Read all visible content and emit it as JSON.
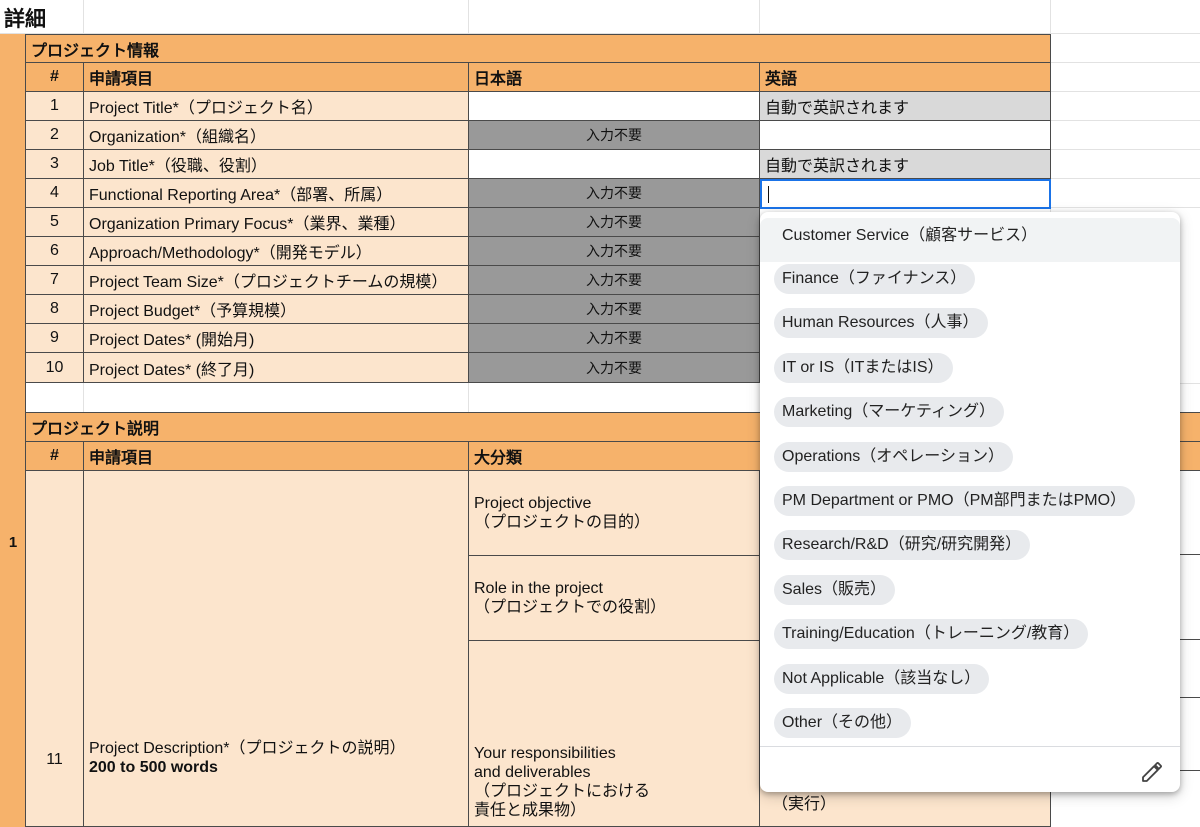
{
  "sheet_title": "詳細",
  "left_row_number": "1",
  "section1": {
    "title": "プロジェクト情報",
    "headers": {
      "num": "#",
      "item": "申請項目",
      "japanese": "日本語",
      "english": "英語"
    },
    "rows": [
      {
        "num": "1",
        "item": "Project Title*（プロジェクト名）",
        "ja": "",
        "en": "自動で英訳されます"
      },
      {
        "num": "2",
        "item": "Organization*（組織名）",
        "ja": "入力不要",
        "en": ""
      },
      {
        "num": "3",
        "item": "Job Title*（役職、役割）",
        "ja": "",
        "en": "自動で英訳されます"
      },
      {
        "num": "4",
        "item": "Functional Reporting Area*（部署、所属）",
        "ja": "入力不要",
        "en": ""
      },
      {
        "num": "5",
        "item": "Organization Primary Focus*（業界、業種）",
        "ja": "入力不要",
        "en": ""
      },
      {
        "num": "6",
        "item": "Approach/Methodology*（開発モデル）",
        "ja": "入力不要",
        "en": ""
      },
      {
        "num": "7",
        "item": "Project Team Size*（プロジェクトチームの規模）",
        "ja": "入力不要",
        "en": ""
      },
      {
        "num": "8",
        "item": "Project Budget*（予算規模）",
        "ja": "入力不要",
        "en": ""
      },
      {
        "num": "9",
        "item": "Project Dates* (開始月)",
        "ja": "入力不要",
        "en": ""
      },
      {
        "num": "10",
        "item": "Project Dates* (終了月)",
        "ja": "入力不要",
        "en": ""
      }
    ]
  },
  "section2": {
    "title": "プロジェクト説明",
    "headers": {
      "num": "#",
      "item": "申請項目",
      "category": "大分類"
    },
    "row": {
      "num": "11",
      "item": "Project Description*（プロジェクトの説明）",
      "item_note": "200 to 500 words",
      "categories": [
        {
          "en": "Project objective",
          "ja": "（プロジェクトの目的）"
        },
        {
          "en": "Role in the project",
          "ja": "（プロジェクトでの役割）"
        },
        {
          "en1": "Your responsibilities",
          "en2": "and deliverables",
          "ja1": "（プロジェクトにおける",
          "ja2": "責任と成果物）"
        }
      ],
      "partial_right_text": "（実行）"
    }
  },
  "dropdown": {
    "options": [
      "Customer Service（顧客サービス）",
      "Finance（ファイナンス）",
      "Human Resources（人事）",
      "IT or IS（ITまたはIS）",
      "Marketing（マーケティング）",
      "Operations（オペレーション）",
      "PM Department or PMO（PM部門またはPMO）",
      "Research/R&D（研究/研究開発）",
      "Sales（販売）",
      "Training/Education（トレーニング/教育）",
      "Not Applicable（該当なし）",
      "Other（その他）"
    ],
    "highlighted_index": 0,
    "edit_icon": "pencil-icon"
  },
  "colors": {
    "peach": "#fce5cd",
    "orange": "#f6b26b",
    "gray_cell": "#999999",
    "light_gray_cell": "#d9d9d9",
    "selection_blue": "#1a73e8",
    "chip": "#e8eaed"
  }
}
